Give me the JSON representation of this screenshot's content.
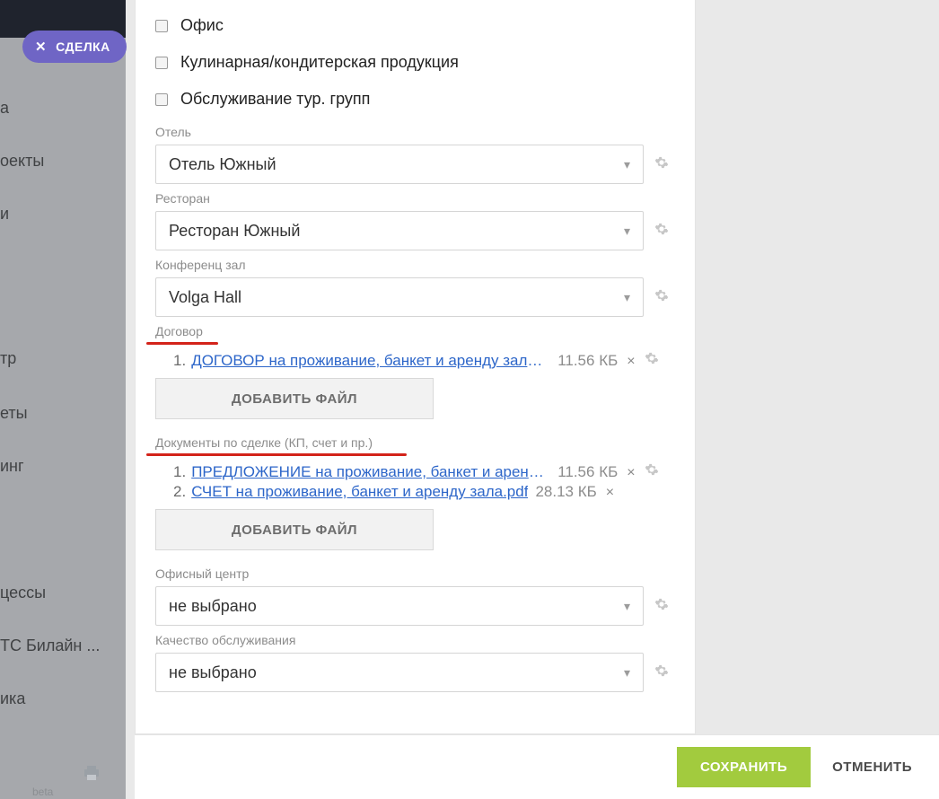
{
  "dealPill": {
    "label": "СДЕЛКА"
  },
  "nav": {
    "items": [
      "а",
      "оекты",
      "и",
      "тр",
      "еты",
      "инг",
      "цессы",
      "ТС Билайн ...",
      "ика"
    ],
    "beta": "beta"
  },
  "checkboxes": [
    {
      "label": "Офис"
    },
    {
      "label": "Кулинарная/кондитерская продукция"
    },
    {
      "label": "Обслуживание тур. групп"
    }
  ],
  "fields": {
    "hotel": {
      "label": "Отель",
      "value": "Отель Южный"
    },
    "restaurant": {
      "label": "Ресторан",
      "value": "Ресторан Южный"
    },
    "confHall": {
      "label": "Конференц зал",
      "value": "Volga Hall"
    },
    "contract": {
      "label": "Договор",
      "files": [
        {
          "name": "ДОГОВОР на проживание, банкет и аренду зала.docx",
          "size": "11.56 КБ"
        }
      ],
      "addBtn": "ДОБАВИТЬ ФАЙЛ"
    },
    "dealDocs": {
      "label": "Документы по сделке (КП, счет и пр.)",
      "files": [
        {
          "name": "ПРЕДЛОЖЕНИЕ на проживание, банкет и аренду за...",
          "size": "11.56 КБ"
        },
        {
          "name": "СЧЕТ на проживание, банкет и аренду зала.pdf",
          "size": "28.13 КБ"
        }
      ],
      "addBtn": "ДОБАВИТЬ ФАЙЛ"
    },
    "officeCenter": {
      "label": "Офисный центр",
      "value": "не выбрано"
    },
    "quality": {
      "label": "Качество обслуживания",
      "value": "не выбрано"
    }
  },
  "footer": {
    "save": "СОХРАНИТЬ",
    "cancel": "ОТМЕНИТЬ"
  }
}
